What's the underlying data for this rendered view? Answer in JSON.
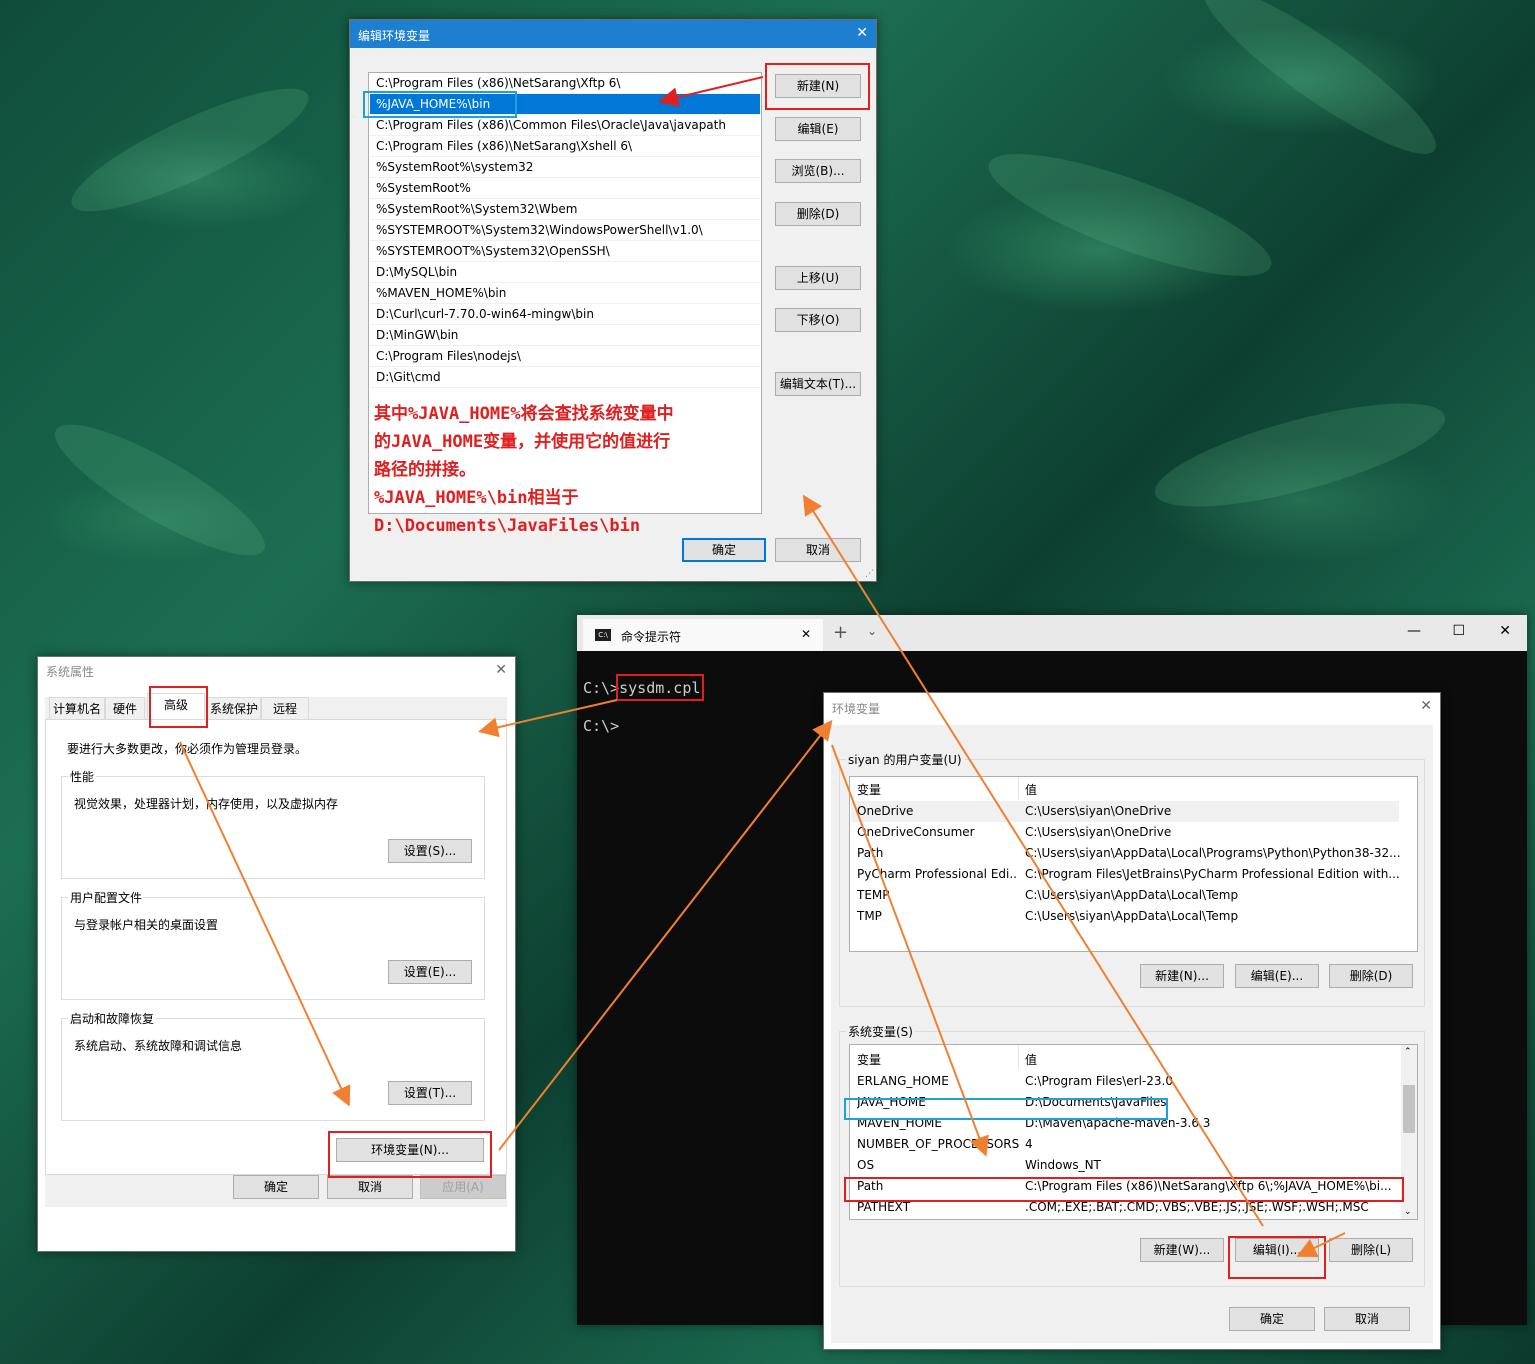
{
  "edit_env_dialog": {
    "title": "编辑环境变量",
    "paths": [
      "C:\\Program Files (x86)\\NetSarang\\Xftp 6\\",
      "%JAVA_HOME%\\bin",
      "C:\\Program Files (x86)\\Common Files\\Oracle\\Java\\javapath",
      "C:\\Program Files (x86)\\NetSarang\\Xshell 6\\",
      "%SystemRoot%\\system32",
      "%SystemRoot%",
      "%SystemRoot%\\System32\\Wbem",
      "%SYSTEMROOT%\\System32\\WindowsPowerShell\\v1.0\\",
      "%SYSTEMROOT%\\System32\\OpenSSH\\",
      "D:\\MySQL\\bin",
      "%MAVEN_HOME%\\bin",
      "D:\\Curl\\curl-7.70.0-win64-mingw\\bin",
      "D:\\MinGW\\bin",
      "C:\\Program Files\\nodejs\\",
      "D:\\Git\\cmd"
    ],
    "buttons": {
      "new": "新建(N)",
      "edit": "编辑(E)",
      "browse": "浏览(B)...",
      "delete": "删除(D)",
      "up": "上移(U)",
      "down": "下移(O)",
      "edit_text": "编辑文本(T)...",
      "ok": "确定",
      "cancel": "取消"
    },
    "annotation": {
      "line1": "其中%JAVA_HOME%将会查找系统变量中",
      "line2": "的JAVA_HOME变量，并使用它的值进行",
      "line3": "路径的拼接。",
      "line4": "%JAVA_HOME%\\bin相当于",
      "line5": "D:\\Documents\\JavaFiles\\bin"
    }
  },
  "sys_props_dialog": {
    "title": "系统属性",
    "tabs": [
      "计算机名",
      "硬件",
      "高级",
      "系统保护",
      "远程"
    ],
    "admin_note": "要进行大多数更改，你必须作为管理员登录。",
    "performance": {
      "label": "性能",
      "desc": "视觉效果，处理器计划，内存使用，以及虚拟内存",
      "button": "设置(S)..."
    },
    "user_profile": {
      "label": "用户配置文件",
      "desc": "与登录帐户相关的桌面设置",
      "button": "设置(E)..."
    },
    "startup": {
      "label": "启动和故障恢复",
      "desc": "系统启动、系统故障和调试信息",
      "button": "设置(T)..."
    },
    "env_button": "环境变量(N)...",
    "ok": "确定",
    "cancel": "取消",
    "apply": "应用(A)"
  },
  "terminal": {
    "tab_title": "命令提示符",
    "line1_prompt": "C:\\>",
    "line1_cmd": "sysdm.cpl",
    "line2_prompt": "C:\\>"
  },
  "env_vars_dialog": {
    "title": "环境变量",
    "user_section": "siyan 的用户变量(U)",
    "col_var": "变量",
    "col_val": "值",
    "user_vars": [
      {
        "name": "OneDrive",
        "value": "C:\\Users\\siyan\\OneDrive"
      },
      {
        "name": "OneDriveConsumer",
        "value": "C:\\Users\\siyan\\OneDrive"
      },
      {
        "name": "Path",
        "value": "C:\\Users\\siyan\\AppData\\Local\\Programs\\Python\\Python38-32..."
      },
      {
        "name": "PyCharm Professional Edi...",
        "value": "C:\\Program Files\\JetBrains\\PyCharm Professional Edition with..."
      },
      {
        "name": "TEMP",
        "value": "C:\\Users\\siyan\\AppData\\Local\\Temp"
      },
      {
        "name": "TMP",
        "value": "C:\\Users\\siyan\\AppData\\Local\\Temp"
      }
    ],
    "user_buttons": {
      "new": "新建(N)...",
      "edit": "编辑(E)...",
      "delete": "删除(D)"
    },
    "sys_section": "系统变量(S)",
    "sys_vars": [
      {
        "name": "ERLANG_HOME",
        "value": "C:\\Program Files\\erl-23.0"
      },
      {
        "name": "JAVA_HOME",
        "value": "D:\\Documents\\JavaFiles"
      },
      {
        "name": "MAVEN_HOME",
        "value": "D:\\Maven\\apache-maven-3.6.3"
      },
      {
        "name": "NUMBER_OF_PROCESSORS",
        "value": "4"
      },
      {
        "name": "OS",
        "value": "Windows_NT"
      },
      {
        "name": "Path",
        "value": "C:\\Program Files (x86)\\NetSarang\\Xftp 6\\;%JAVA_HOME%\\bi..."
      },
      {
        "name": "PATHEXT",
        "value": ".COM;.EXE;.BAT;.CMD;.VBS;.VBE;.JS;.JSE;.WSF;.WSH;.MSC"
      }
    ],
    "sys_buttons": {
      "new": "新建(W)...",
      "edit": "编辑(I)...",
      "delete": "删除(L)"
    },
    "ok": "确定",
    "cancel": "取消"
  },
  "colors": {
    "annotation_red": "#e02020",
    "highlight_blue": "#1ba0e2",
    "arrow_orange": "#f08030",
    "selection": "#0078d7"
  }
}
